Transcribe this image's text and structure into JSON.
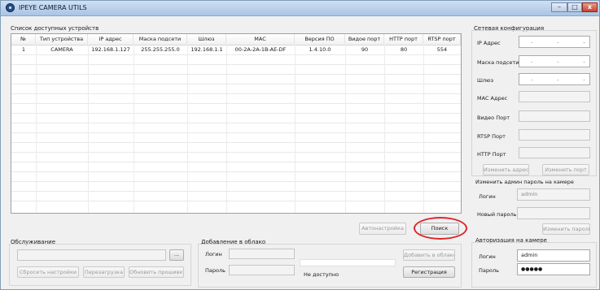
{
  "window": {
    "title": "IPEYE CAMERA UTILS",
    "min_glyph": "–",
    "max_glyph": "□",
    "close_glyph": "x",
    "app_icon": "camera-lens-icon"
  },
  "device_list": {
    "label": "Список доступных устройств",
    "columns": [
      "№",
      "Тип устройства",
      "IP адрес",
      "Маска подсети",
      "Шлюз",
      "MAC",
      "Версия ПО",
      "Видое порт",
      "HTTP порт",
      "RTSP порт"
    ],
    "rows": [
      [
        "1",
        "CAMERA",
        "192.168.1.127",
        "255.255.255.0",
        "192.168.1.1",
        "00-2A-2A-1B-AE-DF",
        "1.4.10.0",
        "90",
        "80",
        "554"
      ]
    ]
  },
  "buttons": {
    "autoconfig": "Автонастройка",
    "search": "Поиск"
  },
  "maintenance": {
    "label": "Обслуживание",
    "file_path_value": "",
    "browse_label": "...",
    "reset_label": "Сбросить настройки",
    "reboot_label": "Перезагрузка",
    "update_firmware_label": "Обновить прошивку"
  },
  "cloud": {
    "label": "Добавление в облако",
    "login_label": "Логин",
    "login_value": "",
    "password_label": "Пароль",
    "password_value": "",
    "add_label": "Добавить в облако",
    "register_label": "Регистрация",
    "status_text": "Не доступно"
  },
  "network": {
    "label": "Сетевая конфигурация",
    "ip_label": "IP Адрес",
    "ip_value": ". . .",
    "mask_label": "Маска подсети",
    "mask_value": ". . .",
    "gateway_label": "Шлюз",
    "gateway_value": ". . .",
    "mac_label": "MAC Адрес",
    "mac_value": "",
    "video_port_label": "Видео Порт",
    "video_port_value": "",
    "rtsp_port_label": "RTSP Порт",
    "rtsp_port_value": "",
    "http_port_label": "HTTP Порт",
    "http_port_value": "",
    "change_address_label": "Изменить адрес",
    "change_port_label": "Изменить порт"
  },
  "admin_password": {
    "label": "Изменить админ пароль на камере",
    "login_label": "Логин",
    "login_value": "admin",
    "new_password_label": "Новый пароль",
    "new_password_value": "",
    "change_label": "Изменить пароль"
  },
  "camera_auth": {
    "label": "Авторизация на камере",
    "login_label": "Логин",
    "login_value": "admin",
    "password_label": "Пароль",
    "password_value": "●●●●●"
  },
  "colors": {
    "highlight_ring": "#e0252b",
    "titlebar": "#a9c4e4"
  }
}
